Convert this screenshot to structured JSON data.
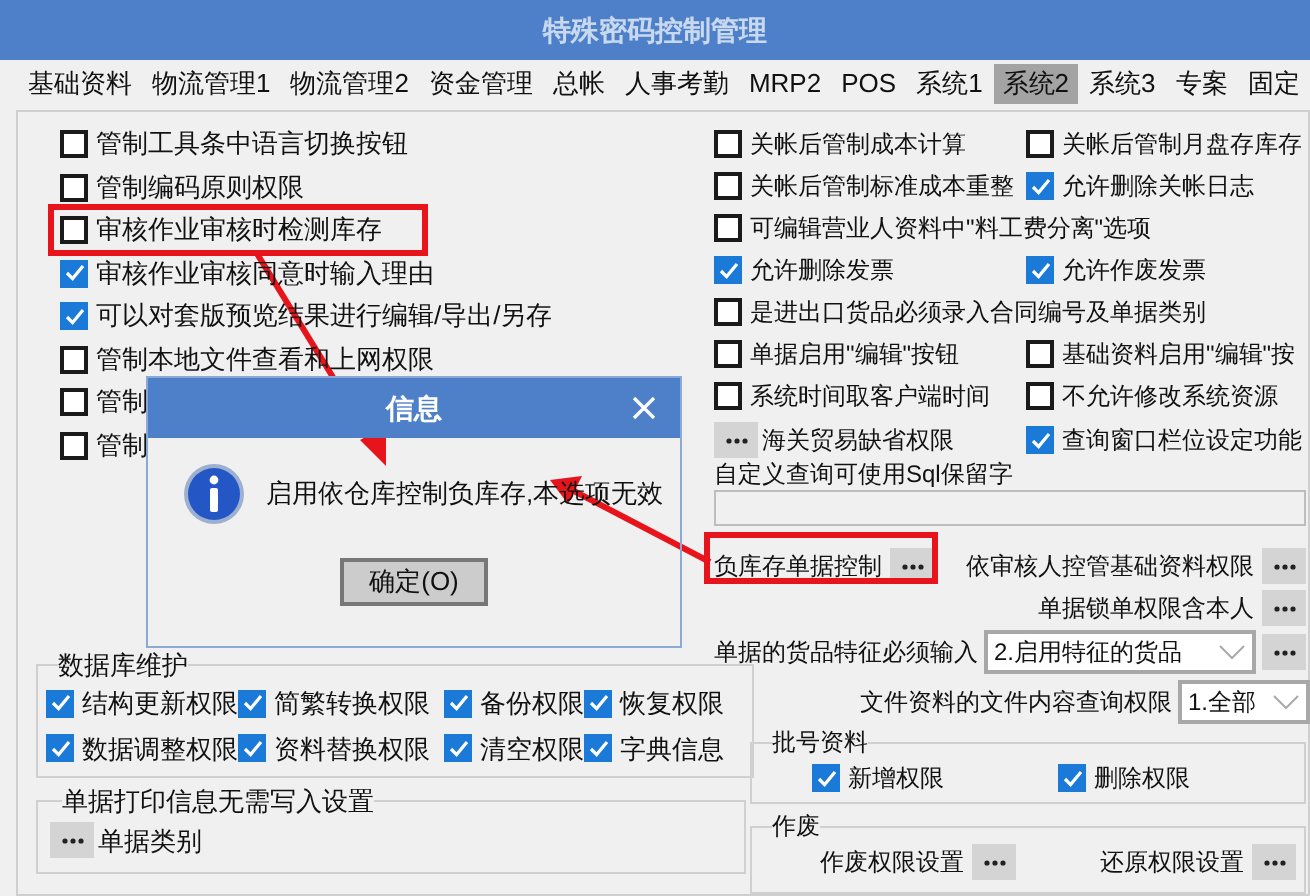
{
  "window": {
    "title": "特殊密码控制管理"
  },
  "tabs": [
    {
      "label": "基础资料",
      "selected": false
    },
    {
      "label": "物流管理1",
      "selected": false
    },
    {
      "label": "物流管理2",
      "selected": false
    },
    {
      "label": "资金管理",
      "selected": false
    },
    {
      "label": "总帐",
      "selected": false
    },
    {
      "label": "人事考勤",
      "selected": false
    },
    {
      "label": "MRP2",
      "selected": false
    },
    {
      "label": "POS",
      "selected": false
    },
    {
      "label": "系统1",
      "selected": false
    },
    {
      "label": "系统2",
      "selected": true
    },
    {
      "label": "系统3",
      "selected": false
    },
    {
      "label": "专案",
      "selected": false
    },
    {
      "label": "固定",
      "selected": false
    }
  ],
  "left_options": [
    {
      "label": "管制工具条中语言切换按钮",
      "checked": false
    },
    {
      "label": "管制编码原则权限",
      "checked": false
    },
    {
      "label": "审核作业审核时检测库存",
      "checked": false
    },
    {
      "label": "审核作业审核同意时输入理由",
      "checked": true
    },
    {
      "label": "可以对套版预览结果进行编辑/导出/另存",
      "checked": true
    },
    {
      "label": "管制本地文件查看和上网权限",
      "checked": false
    },
    {
      "label": "管制",
      "checked": false
    },
    {
      "label": "管制",
      "checked": false
    }
  ],
  "right_options": [
    [
      {
        "kind": "checkbox",
        "label": "关帐后管制成本计算",
        "checked": false
      },
      {
        "kind": "checkbox",
        "label": "关帐后管制月盘存库存",
        "checked": false
      }
    ],
    [
      {
        "kind": "checkbox",
        "label": "关帐后管制标准成本重整",
        "checked": false
      },
      {
        "kind": "checkbox",
        "label": "允许删除关帐日志",
        "checked": true
      }
    ],
    [
      {
        "kind": "checkbox",
        "label": "可编辑营业人资料中\"料工费分离\"选项",
        "checked": false
      }
    ],
    [
      {
        "kind": "checkbox",
        "label": "允许删除发票",
        "checked": true
      },
      {
        "kind": "checkbox",
        "label": "允许作废发票",
        "checked": true
      }
    ],
    [
      {
        "kind": "checkbox",
        "label": "是进出口货品必须录入合同编号及单据类别",
        "checked": false
      }
    ],
    [
      {
        "kind": "checkbox",
        "label": "单据启用\"编辑\"按钮",
        "checked": false
      },
      {
        "kind": "checkbox",
        "label": "基础资料启用\"编辑\"按",
        "checked": false
      }
    ],
    [
      {
        "kind": "checkbox",
        "label": "系统时间取客户端时间",
        "checked": false
      },
      {
        "kind": "checkbox",
        "label": "不允许修改系统资源",
        "checked": false
      }
    ],
    [
      {
        "kind": "button",
        "label": "海关贸易缺省权限"
      },
      {
        "kind": "checkbox",
        "label": "查询窗口栏位设定功能",
        "checked": true
      }
    ]
  ],
  "sql_reserved": {
    "label": "自定义查询可使用Sql保留字"
  },
  "negative_stock": {
    "label": "负库存单据控制"
  },
  "reviewer_control": {
    "label": "依审核人控管基础资料权限"
  },
  "lock_self": {
    "label": "单据锁单权限含本人"
  },
  "feature_input": {
    "label": "单据的货品特征必须输入",
    "value": "2.启用特征的货品"
  },
  "file_query": {
    "label": "文件资料的文件内容查询权限",
    "value": "1.全部"
  },
  "db_maintenance": {
    "title": "数据库维护",
    "options": [
      {
        "label": "结构更新权限",
        "checked": true
      },
      {
        "label": "简繁转换权限",
        "checked": true
      },
      {
        "label": "备份权限",
        "checked": true
      },
      {
        "label": "恢复权限",
        "checked": true
      },
      {
        "label": "数据调整权限",
        "checked": true
      },
      {
        "label": "资料替换权限",
        "checked": true
      },
      {
        "label": "清空权限",
        "checked": true
      },
      {
        "label": "字典信息",
        "checked": true
      }
    ]
  },
  "print_settings": {
    "title": "单据打印信息无需写入设置",
    "button": "单据类别"
  },
  "batch": {
    "title": "批号资料",
    "options": [
      {
        "label": "新增权限",
        "checked": true
      },
      {
        "label": "删除权限",
        "checked": true
      }
    ]
  },
  "void": {
    "title": "作废",
    "buttons": [
      "作废权限设置",
      "还原权限设置"
    ]
  },
  "dialog": {
    "title": "信息",
    "message": "启用依仓库控制负库存,本选项无效",
    "button": "确定(O)"
  }
}
